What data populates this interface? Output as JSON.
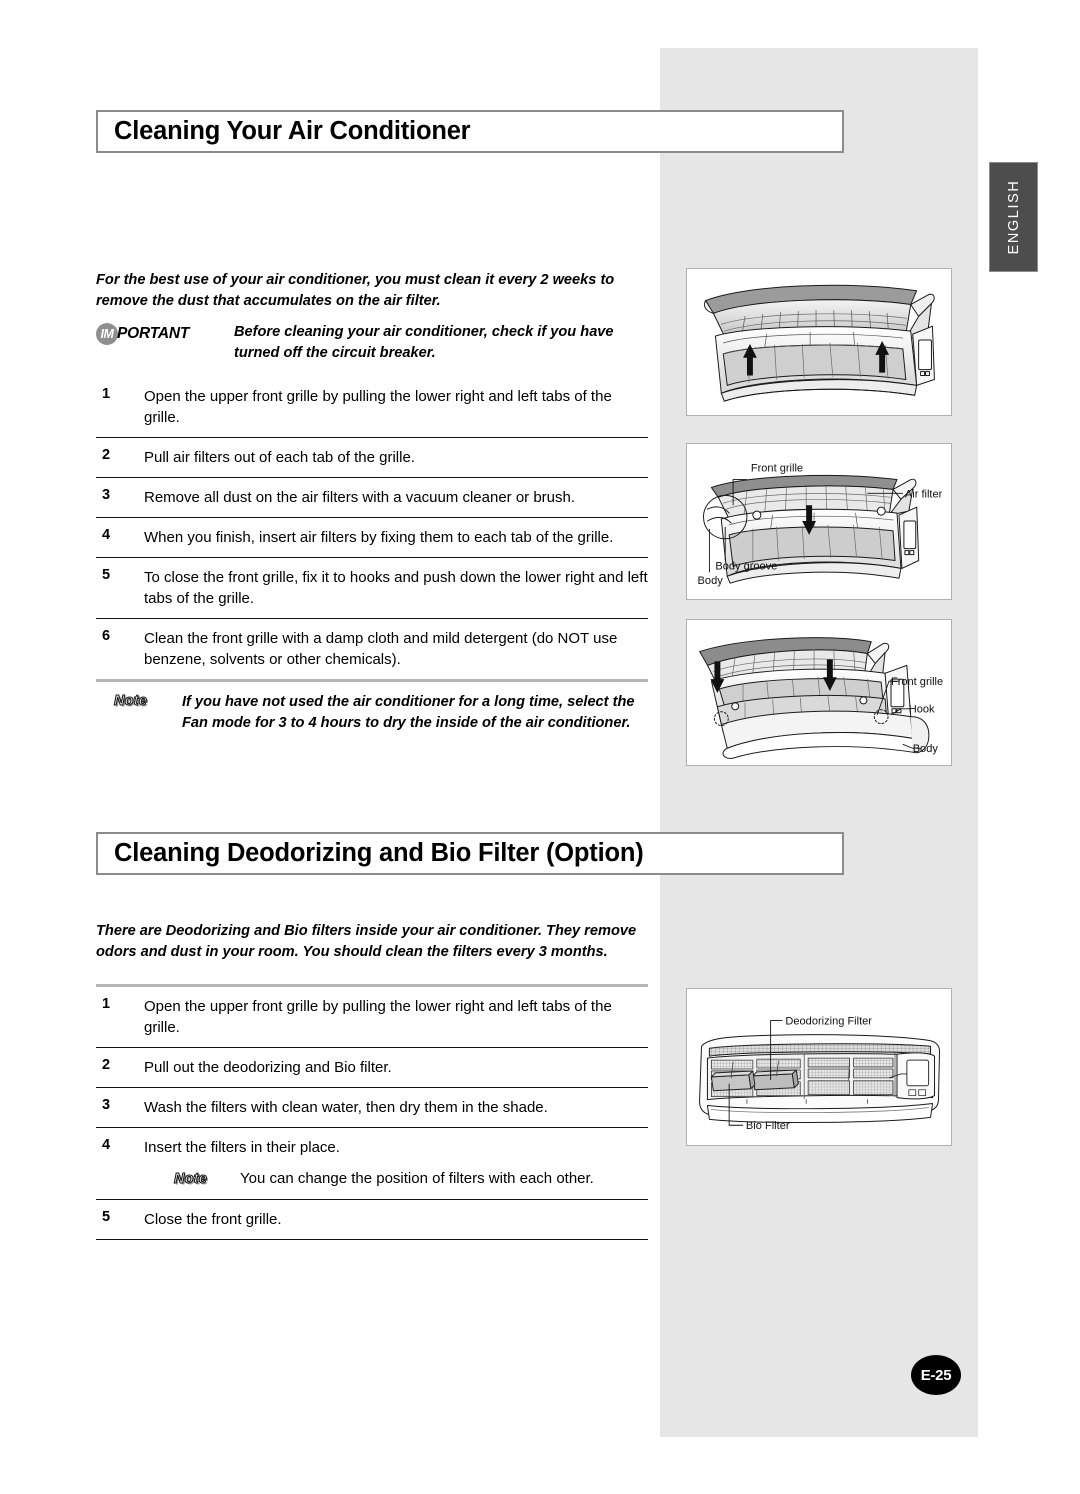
{
  "page": {
    "language_tab": "ENGLISH",
    "page_number": "E-25",
    "colors": {
      "panel_gray": "#e6e6e6",
      "tab_gray": "#4d4d4d",
      "heading_border": "#8c8c8c",
      "rule_dark": "#111111",
      "rule_light": "#b5b5b5",
      "badge_gray": "#8f8f8f"
    }
  },
  "section1": {
    "heading": "Cleaning Your Air Conditioner",
    "lead": "For the best use of your air conditioner, you must clean it every 2 weeks to remove the dust that accumulates on the air filter.",
    "important": {
      "badge_circle": "IM",
      "badge_rest": "PORTANT",
      "text": "Before cleaning your air conditioner, check if you have turned off the circuit breaker."
    },
    "steps": [
      {
        "num": "1",
        "text": "Open the upper front grille by pulling the lower right and left tabs of the grille."
      },
      {
        "num": "2",
        "text": "Pull air filters out of each tab of the grille."
      },
      {
        "num": "3",
        "text": "Remove all dust on the air filters with a vacuum cleaner or brush."
      },
      {
        "num": "4",
        "text": "When you finish, insert air filters by fixing them to each tab of the grille."
      },
      {
        "num": "5",
        "text": "To close the front grille, fix it to hooks and push down the lower right and left tabs of the grille."
      },
      {
        "num": "6",
        "text": "Clean the front grille with a damp cloth and mild detergent (do NOT use benzene, solvents or other chemicals)."
      }
    ],
    "note": {
      "label": "Note",
      "text": "If you have not used the air conditioner for a long time, select the Fan mode for 3 to 4 hours to dry the inside of the air conditioner."
    }
  },
  "section2": {
    "heading": "Cleaning Deodorizing and Bio Filter (Option)",
    "lead": "There are Deodorizing and Bio filters inside your air conditioner. They remove odors and dust in your room. You should clean the filters every 3 months.",
    "steps": [
      {
        "num": "1",
        "text": "Open the upper front grille by pulling the lower right and left tabs of the grille."
      },
      {
        "num": "2",
        "text": "Pull out the deodorizing and Bio filter."
      },
      {
        "num": "3",
        "text": "Wash the filters with clean water, then dry them in the shade."
      },
      {
        "num": "4",
        "text": "Insert the filters in their place."
      },
      {
        "num": "5",
        "text": "Close the front grille."
      }
    ],
    "inline_note": {
      "label": "Note",
      "text": "You can change the position of filters with each other."
    }
  },
  "figures": {
    "fig1": {
      "caption_alt": "Air conditioner with front grille lifted open, two upward arrows",
      "labels": []
    },
    "fig2": {
      "caption_alt": "Air conditioner with air filter being removed, downward arrow",
      "labels": [
        "Front grille",
        "Air filter",
        "Body groove",
        "Body"
      ]
    },
    "fig3": {
      "caption_alt": "Air conditioner front grille being closed, two downward arrows",
      "labels": [
        "Front grille",
        "Hook",
        "Body"
      ]
    },
    "fig4": {
      "caption_alt": "Front view of indoor unit showing filter locations",
      "labels": [
        "Deodorizing Filter",
        "Bio Filter"
      ]
    }
  }
}
